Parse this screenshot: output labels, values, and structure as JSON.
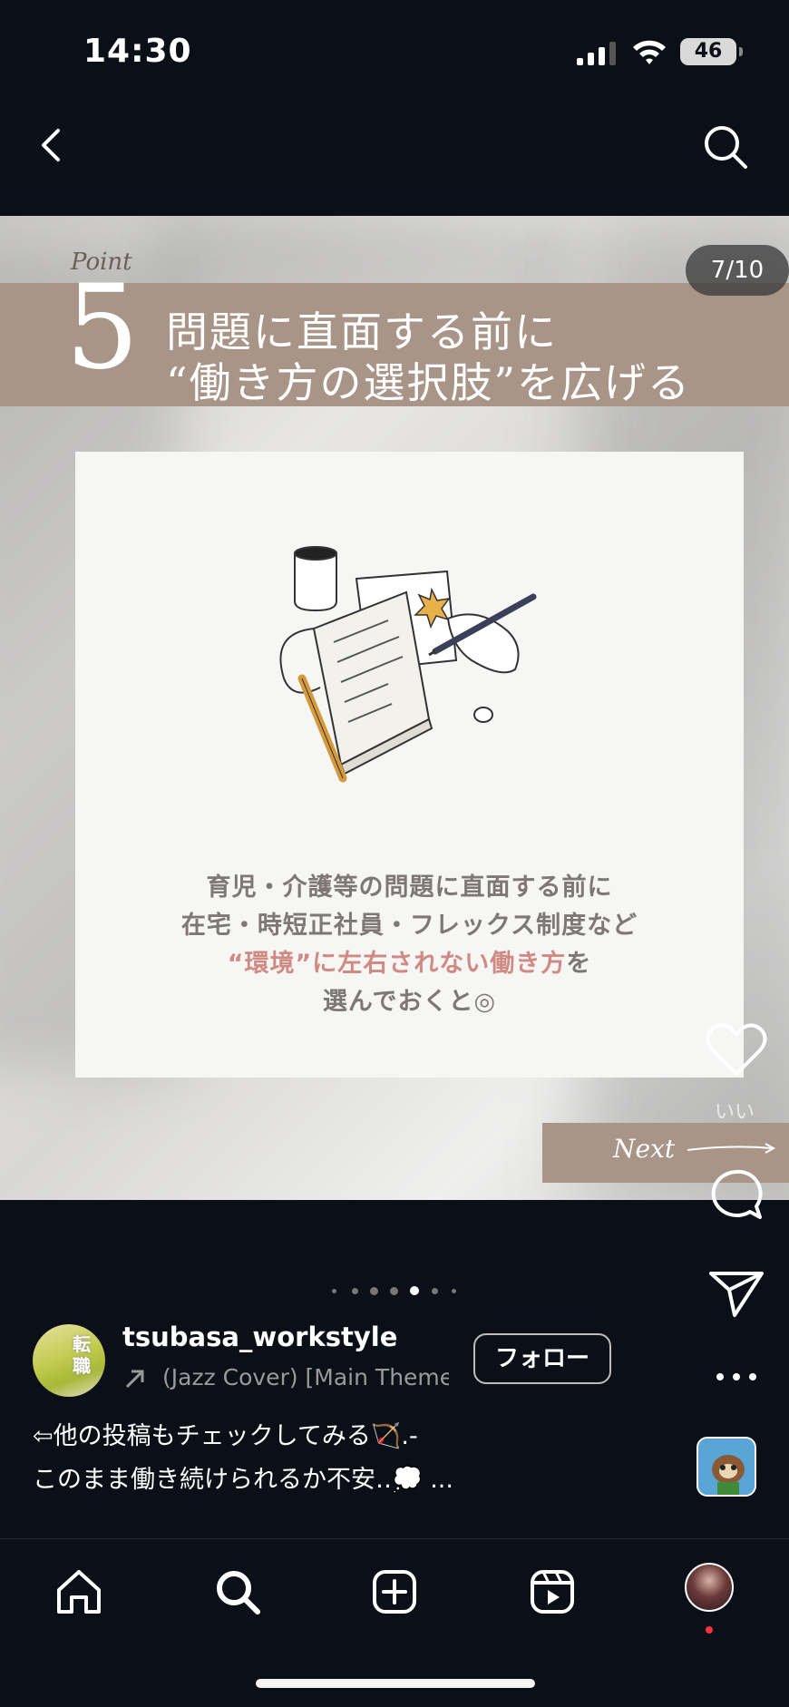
{
  "status_bar": {
    "time": "14:30",
    "battery": "46"
  },
  "post": {
    "point_label": "Point",
    "point_number": "5",
    "title_line1": "問題に直面する前に",
    "title_line2": "“働き方の選択肢”を広げる",
    "counter": "7/10",
    "body_line1": "育児・介護等の問題に直面する前に",
    "body_line2": "在宅・時短正社員・フレックス制度など",
    "body_line3_accent": "“環境”に左右されない働き方",
    "body_line3_rest": "を",
    "body_line4": "選んでおくと◎",
    "next_label": "Next"
  },
  "actions": {
    "like_caption": "いい"
  },
  "carousel": {
    "total_dots": 7,
    "active_index": 4
  },
  "profile": {
    "username": "tsubasa_workstyle",
    "avatar_text": "転\n職",
    "music": "(Jazz Cover) [Main Theme]",
    "follow_label": "フォロー"
  },
  "caption": {
    "line1": "⇦他の投稿もチェックしてみる🏹.-",
    "line2": "このまま働き続けられるか不安‥💭 ..."
  },
  "icons": {
    "back": "chevron-left-icon",
    "search": "search-icon",
    "like": "heart-icon",
    "comment": "comment-icon",
    "share": "send-icon",
    "more": "more-icon",
    "home": "home-icon",
    "explore": "search-icon",
    "create": "plus-square-icon",
    "reels": "reels-icon",
    "profile": "profile-avatar"
  },
  "colors": {
    "band": "#a99488",
    "accent_text": "#d08a84",
    "background": "#0b0f17",
    "notification": "#ff3040"
  }
}
